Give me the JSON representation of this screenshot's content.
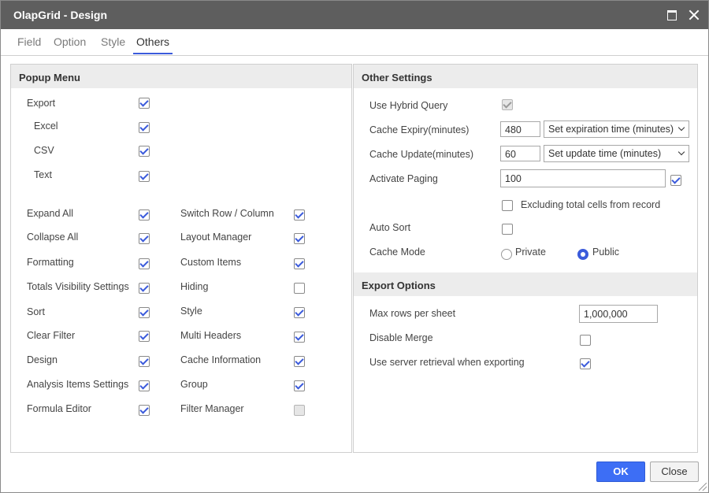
{
  "window": {
    "title": "OlapGrid - Design"
  },
  "tabs": [
    {
      "label": "Field"
    },
    {
      "label": "Option"
    },
    {
      "label": "Style"
    },
    {
      "label": "Others"
    }
  ],
  "popup_menu": {
    "title": "Popup Menu",
    "export": {
      "label": "Export",
      "checked": true
    },
    "export_items": [
      {
        "label": "Excel",
        "checked": true
      },
      {
        "label": "CSV",
        "checked": true
      },
      {
        "label": "Text",
        "checked": true
      }
    ],
    "left_items": [
      {
        "label": "Expand All",
        "checked": true
      },
      {
        "label": "Collapse All",
        "checked": true
      },
      {
        "label": "Formatting",
        "checked": true
      },
      {
        "label": "Totals Visibility Settings",
        "checked": true
      },
      {
        "label": "Sort",
        "checked": true
      },
      {
        "label": "Clear Filter",
        "checked": true
      },
      {
        "label": "Design",
        "checked": true
      },
      {
        "label": "Analysis Items Settings",
        "checked": true
      },
      {
        "label": "Formula Editor",
        "checked": true
      }
    ],
    "right_items": [
      {
        "label": "Switch Row / Column",
        "checked": true
      },
      {
        "label": "Layout Manager",
        "checked": true
      },
      {
        "label": "Custom Items",
        "checked": true
      },
      {
        "label": "Hiding",
        "checked": false
      },
      {
        "label": "Style",
        "checked": true
      },
      {
        "label": "Multi Headers",
        "checked": true
      },
      {
        "label": "Cache Information",
        "checked": true
      },
      {
        "label": "Group",
        "checked": true
      },
      {
        "label": "Filter Manager",
        "checked": false,
        "disabled": true
      }
    ]
  },
  "other_settings": {
    "title": "Other Settings",
    "use_hybrid_query": {
      "label": "Use Hybrid Query",
      "checked": true,
      "disabled": true
    },
    "cache_expiry": {
      "label": "Cache Expiry(minutes)",
      "value": "480",
      "select": "Set expiration time (minutes)"
    },
    "cache_update": {
      "label": "Cache Update(minutes)",
      "value": "60",
      "select": "Set update time (minutes)"
    },
    "activate_paging": {
      "label": "Activate Paging",
      "value": "100",
      "checked": true
    },
    "excluding_total": {
      "label": "Excluding total cells from record",
      "checked": false
    },
    "auto_sort": {
      "label": "Auto Sort",
      "checked": false
    },
    "cache_mode": {
      "label": "Cache Mode",
      "options": [
        "Private",
        "Public"
      ],
      "selected": "Public"
    }
  },
  "export_options": {
    "title": "Export Options",
    "max_rows": {
      "label": "Max rows per sheet",
      "value": "1,000,000"
    },
    "disable_merge": {
      "label": "Disable Merge",
      "checked": false
    },
    "server_retrieval": {
      "label": "Use server retrieval when exporting",
      "checked": true
    }
  },
  "footer": {
    "ok_label": "OK",
    "close_label": "Close"
  },
  "colors": {
    "accent": "#3b5bdb",
    "titlebar": "#5e5e5e",
    "ok_button": "#3d6ef5"
  }
}
